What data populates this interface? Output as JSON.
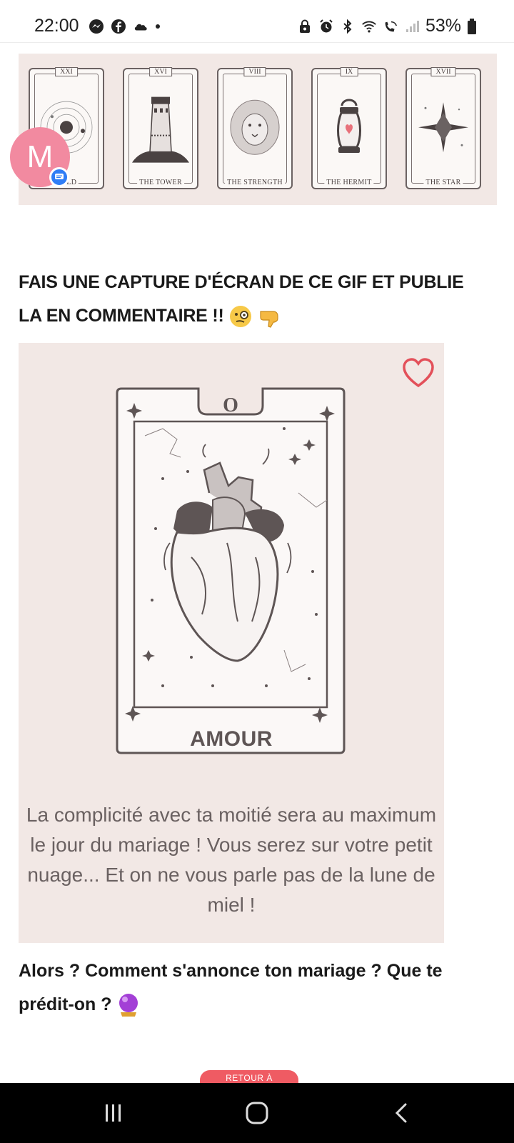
{
  "status_bar": {
    "time": "22:00",
    "battery": "53%",
    "left_icons": [
      "messenger-icon",
      "facebook-icon",
      "cloud-icon",
      "dot-icon"
    ],
    "right_icons": [
      "lock-icon",
      "alarm-icon",
      "bluetooth-icon",
      "wifi-icon",
      "wifi-calling-icon",
      "signal-icon",
      "battery-icon"
    ]
  },
  "tarot_strip": {
    "cards": [
      {
        "number": "XXI",
        "name": "THE WORLD",
        "visible_name": "ORLD"
      },
      {
        "number": "XVI",
        "name": "THE TOWER"
      },
      {
        "number": "VIII",
        "name": "THE STRENGTH"
      },
      {
        "number": "IX",
        "name": "THE HERMIT"
      },
      {
        "number": "XVII",
        "name": "THE STAR"
      }
    ]
  },
  "avatar": {
    "initial": "M"
  },
  "post": {
    "heading": "FAIS UNE CAPTURE D'ÉCRAN DE CE GIF ET PUBLIE LA EN COMMENTAIRE !!",
    "heading_emojis": [
      "monocle-face-emoji",
      "pointing-down-emoji"
    ],
    "card": {
      "number": "O",
      "title": "AMOUR",
      "text": "La complicité avec ta moitié sera au maximum le jour du mariage ! Vous serez sur votre petit nuage... Et on ne vous parle pas de la lune de miel !"
    },
    "question": "Alors ? Comment s'annonce ton mariage ? Que te prédit-on ?",
    "question_emoji": "crystal-ball-emoji",
    "return_button": "RETOUR À"
  },
  "colors": {
    "card_background": "#f2e8e5",
    "avatar": "#f28aa0",
    "accent_red": "#ef5b63",
    "card_ink": "#5e5555"
  }
}
